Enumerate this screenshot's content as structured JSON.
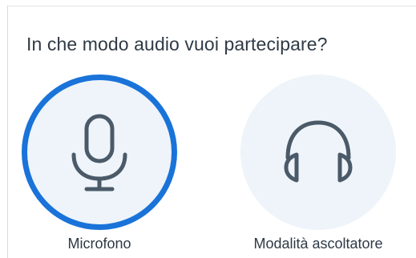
{
  "dialog": {
    "title": "In che modo audio vuoi partecipare?"
  },
  "options": [
    {
      "label": "Microfono",
      "icon": "microphone-icon",
      "selected": true
    },
    {
      "label": "Modalità ascoltatore",
      "icon": "headphones-icon",
      "selected": false
    }
  ],
  "colors": {
    "accent": "#1a73d9",
    "circle_bg": "#eef4f9",
    "icon": "#4b5a69",
    "text": "#2f3a45"
  }
}
